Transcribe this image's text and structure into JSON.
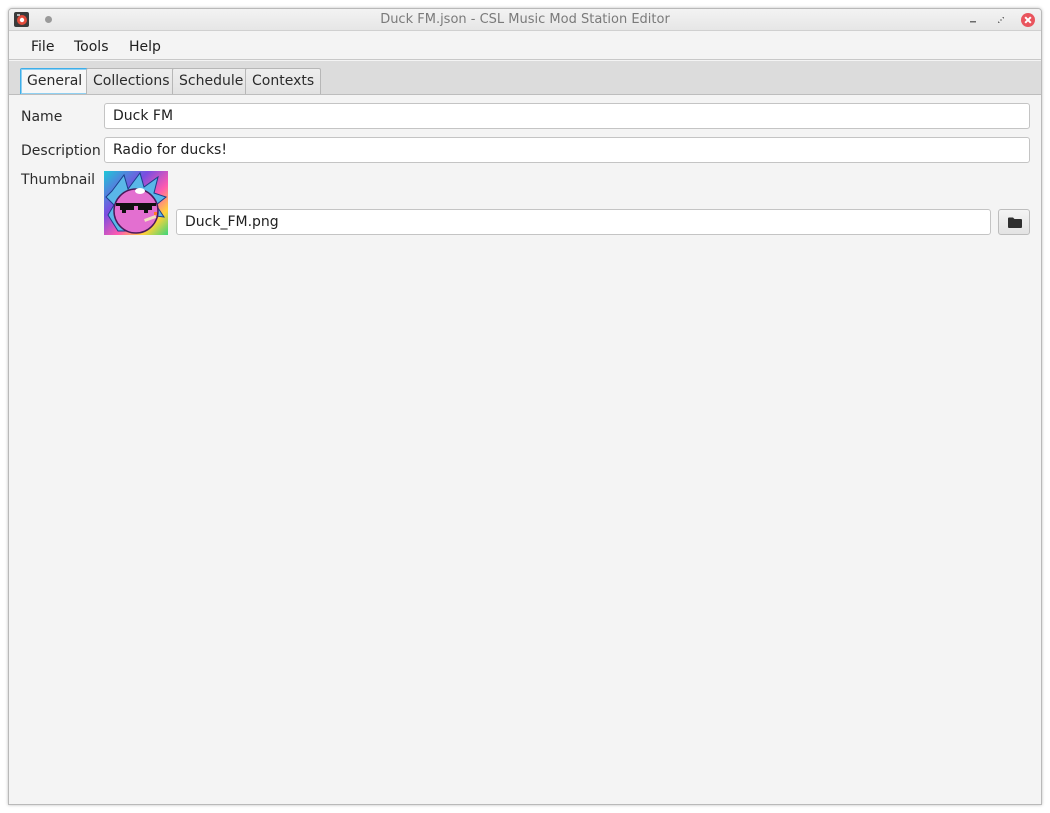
{
  "window": {
    "title": "Duck FM.json - CSL Music Mod Station Editor",
    "close_color": "#e9545d"
  },
  "menu": {
    "items": [
      "File",
      "Tools",
      "Help"
    ]
  },
  "tabs": {
    "items": [
      "General",
      "Collections",
      "Schedule",
      "Contexts"
    ],
    "active": "General",
    "active_color": "#3daee9"
  },
  "general": {
    "name_label": "Name",
    "name_value": "Duck FM",
    "description_label": "Description",
    "description_value": "Radio for ducks!",
    "thumbnail_label": "Thumbnail",
    "thumbnail_file": "Duck_FM.png",
    "browse_icon": "folder-icon"
  }
}
